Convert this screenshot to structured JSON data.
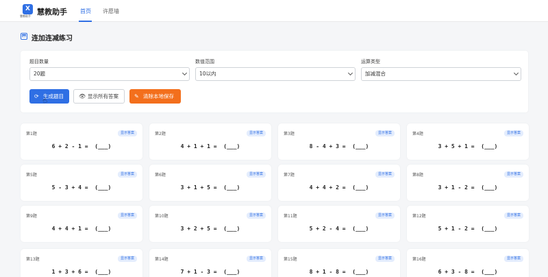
{
  "header": {
    "logo_letter": "X",
    "logo_caption": "慧教助手",
    "brand": "慧教助手",
    "nav": [
      "首页",
      "许愿墙"
    ]
  },
  "section": {
    "title": "连加连减练习"
  },
  "controls": {
    "count": {
      "label": "题目数量",
      "value": "20题"
    },
    "range": {
      "label": "数值范围",
      "value": "10以内"
    },
    "type": {
      "label": "运算类型",
      "value": "加减混合"
    }
  },
  "buttons": {
    "generate": "生成题目",
    "show_all": "显示所有答案",
    "clear": "清除本地保存"
  },
  "badge_label": "显示答案",
  "questions": [
    {
      "num": "第1题",
      "expr": "6 + 2 - 1 =  (___)"
    },
    {
      "num": "第2题",
      "expr": "4 + 1 + 1 =  (___)"
    },
    {
      "num": "第3题",
      "expr": "8 - 4 + 3 =  (___)"
    },
    {
      "num": "第4题",
      "expr": "3 + 5 + 1 =  (___)"
    },
    {
      "num": "第5题",
      "expr": "5 - 3 + 4 =  (___)"
    },
    {
      "num": "第6题",
      "expr": "3 + 1 + 5 =  (___)"
    },
    {
      "num": "第7题",
      "expr": "4 + 4 + 2 =  (___)"
    },
    {
      "num": "第8题",
      "expr": "3 + 1 - 2 =  (___)"
    },
    {
      "num": "第9题",
      "expr": "4 + 4 + 1 =  (___)"
    },
    {
      "num": "第10题",
      "expr": "3 + 2 + 5 =  (___)"
    },
    {
      "num": "第11题",
      "expr": "5 + 2 - 4 =  (___)"
    },
    {
      "num": "第12题",
      "expr": "5 + 1 - 2 =  (___)"
    },
    {
      "num": "第13题",
      "expr": "1 + 3 + 6 =  (___)"
    },
    {
      "num": "第14题",
      "expr": "7 + 1 - 3 =  (___)"
    },
    {
      "num": "第15题",
      "expr": "8 + 1 - 8 =  (___)"
    },
    {
      "num": "第16题",
      "expr": "6 + 3 - 8 =  (___)"
    }
  ]
}
